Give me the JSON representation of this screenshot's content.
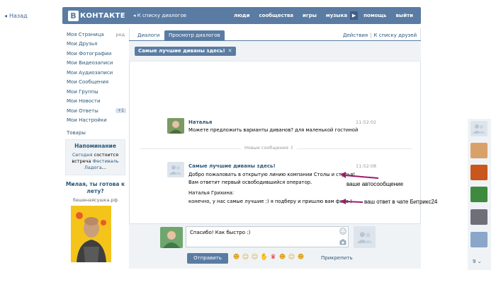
{
  "nav": {
    "back": "Назад",
    "back_to_dialogs": "К списку диалогов"
  },
  "brand": {
    "badge": "В",
    "word": "КОНТАКТЕ"
  },
  "topnav": [
    "люди",
    "сообщества",
    "игры",
    "музыка",
    "помощь",
    "выйти"
  ],
  "leftmenu": {
    "items": [
      {
        "label": "Моя Страница",
        "aux": "ред."
      },
      {
        "label": "Мои Друзья",
        "aux": ""
      },
      {
        "label": "Мои Фотографии",
        "aux": ""
      },
      {
        "label": "Мои Видеозаписи",
        "aux": ""
      },
      {
        "label": "Мои Аудиозаписи",
        "aux": ""
      },
      {
        "label": "Мои Сообщения",
        "aux": ""
      },
      {
        "label": "Мои Группы",
        "aux": ""
      },
      {
        "label": "Мои Новости",
        "aux": ""
      },
      {
        "label": "Мои Ответы",
        "aux": "+1"
      },
      {
        "label": "Мои Настройки",
        "aux": ""
      }
    ],
    "extra": "Товары"
  },
  "reminder": {
    "title": "Напоминание",
    "p1": "Сегодня",
    "p2": " состоится встреча ",
    "p3": "Фестиваль Ладога",
    "p4": "..."
  },
  "ad": {
    "title": "Милая, ты готова к лету?",
    "url": "бешенаясушка.рф"
  },
  "tabs": {
    "dialogs": "Диалоги",
    "view": "Просмотр диалогов"
  },
  "right_links": {
    "actions": "Действия",
    "to_friends": "К списку друзей"
  },
  "topic": {
    "title": "Самые лучшие диваны здесь!",
    "close": "✕"
  },
  "messages": [
    {
      "name": "Наталья",
      "text": "Можете предложить варианты диванов? для маленькой гостиной",
      "time": "11:52:02"
    },
    {
      "name": "Самые лучшие диваны здесь!",
      "lines": [
        "Добро пожаловать в открытую линию компании Столы и стулья!",
        "Вам ответит первый освободившийся оператор.",
        "",
        "Наталья Грихина:",
        "конечно, у нас самые лучшие :) я подберу и пришлю вам фото )"
      ],
      "time": "11:52:08"
    }
  ],
  "separator": "Новые сообщения ⇩",
  "composer": {
    "text": "Спасибо! Как быстро :)",
    "send": "Отправить",
    "attach": "Прикрепить"
  },
  "annotations": {
    "auto": "ваше автосообщение",
    "reply": "ваш ответ в чате Битрикс24"
  },
  "right_count": "9",
  "colors": {
    "accent": "#5a7ca3",
    "link": "#2b587a",
    "arrow": "#9b1b6b"
  }
}
